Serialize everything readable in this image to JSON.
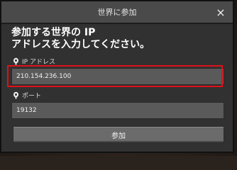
{
  "dialog": {
    "title": "世界に参加",
    "close_glyph": "×",
    "heading": "参加する世界の IP\nアドレスを入力してください。"
  },
  "ip_field": {
    "label": "IP アドレス",
    "value": "210.154.236.100",
    "icon": "pin-icon"
  },
  "port_field": {
    "label": "ポート",
    "value": "19132",
    "icon": "pin-icon"
  },
  "join_button": {
    "label": "参加"
  },
  "colors": {
    "highlight": "#e0101a",
    "panel": "#313131",
    "input_bg": "#5a5a5a"
  }
}
